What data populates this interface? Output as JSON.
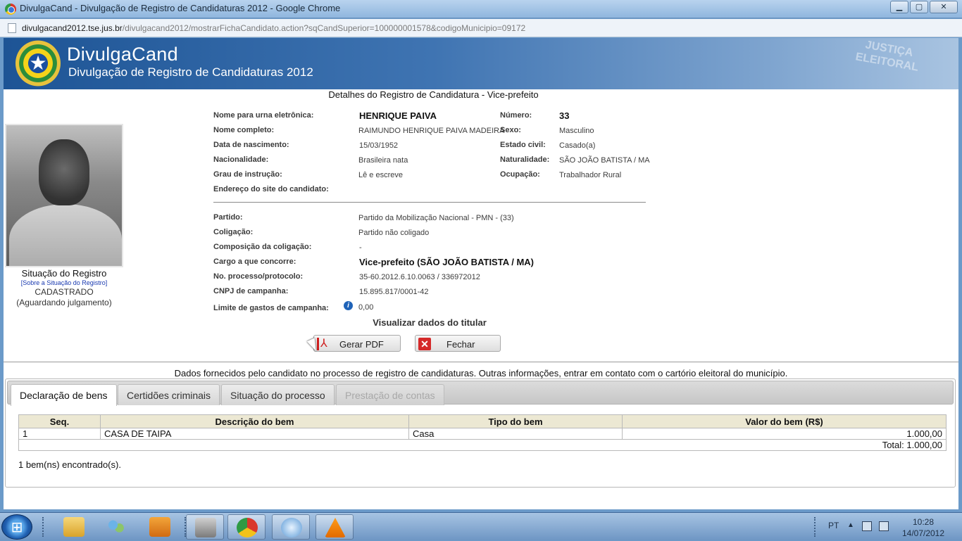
{
  "window": {
    "title": "DivulgaCand - Divulgação de Registro de Candidaturas 2012 - Google Chrome",
    "controls": {
      "minimize": "▁",
      "maximize": "▢",
      "close": "✕"
    }
  },
  "address": {
    "host": "divulgacand2012.tse.jus.br",
    "path": "/divulgacand2012/mostrarFichaCandidato.action?sqCandSuperior=100000001578&codigoMunicipio=09172"
  },
  "banner": {
    "app_name": "DivulgaCand",
    "app_subtitle": "Divulgação de Registro de Candidaturas 2012",
    "stamp_line1": "JUSTIÇA",
    "stamp_line2": "ELEITORAL"
  },
  "section_title": "Detalhes do Registro de Candidatura - Vice-prefeito",
  "registry": {
    "label": "Situação do Registro",
    "link": "[Sobre a Situação do Registro]",
    "value": "CADASTRADO",
    "note": "(Aguardando julgamento)"
  },
  "candidate": {
    "urna_label": "Nome para urna eletrônica:",
    "urna_value": "HENRIQUE PAIVA",
    "numero_label": "Número:",
    "numero_value": "33",
    "nome_label": "Nome completo:",
    "nome_value": "RAIMUNDO HENRIQUE PAIVA MADEIRA",
    "sexo_label": "Sexo:",
    "sexo_value": "Masculino",
    "nasc_label": "Data de nascimento:",
    "nasc_value": "15/03/1952",
    "civil_label": "Estado civil:",
    "civil_value": "Casado(a)",
    "nac_label": "Nacionalidade:",
    "nac_value": "Brasileira nata",
    "natural_label": "Naturalidade:",
    "natural_value": "SÃO JOÃO BATISTA / MA",
    "grau_label": "Grau de instrução:",
    "grau_value": "Lê e escreve",
    "ocup_label": "Ocupação:",
    "ocup_value": "Trabalhador Rural",
    "site_label": "Endereço do site do candidato:",
    "partido_label": "Partido:",
    "partido_value": "Partido da Mobilização Nacional - PMN - (33)",
    "coligacao_label": "Coligação:",
    "coligacao_value": "Partido não coligado",
    "composicao_label": "Composição da coligação:",
    "composicao_value": "-",
    "cargo_label": "Cargo a que concorre:",
    "cargo_value": "Vice-prefeito (SÃO JOÃO BATISTA / MA)",
    "processo_label": "No. processo/protocolo:",
    "processo_value": "35-60.2012.6.10.0063 / 336972012",
    "cnpj_label": "CNPJ de campanha:",
    "cnpj_value": "15.895.817/0001-42",
    "limite_label": "Limite de gastos de campanha:",
    "limite_value": "0,00"
  },
  "link_titular": "Visualizar dados do titular",
  "buttons": {
    "pdf": "Gerar PDF",
    "close": "Fechar"
  },
  "disclaimer": "Dados fornecidos pelo candidato no processo de registro de candidaturas.  Outras informações, entrar em contato com o cartório eleitoral do município.",
  "tabs": [
    {
      "label": "Declaração de bens",
      "state": "active"
    },
    {
      "label": "Certidões criminais",
      "state": "normal"
    },
    {
      "label": "Situação do processo",
      "state": "normal"
    },
    {
      "label": "Prestação de contas",
      "state": "disabled"
    }
  ],
  "assets": {
    "headers": [
      "Seq.",
      "Descrição do bem",
      "Tipo do bem",
      "Valor do bem (R$)"
    ],
    "rows": [
      {
        "seq": "1",
        "descricao": "CASA DE TAIPA",
        "tipo": "Casa",
        "valor": "1.000,00"
      }
    ],
    "total": "Total: 1.000,00",
    "found": "1 bem(ns) encontrado(s)."
  },
  "taskbar": {
    "lang": "PT",
    "time": "10:28",
    "date": "14/07/2012"
  }
}
